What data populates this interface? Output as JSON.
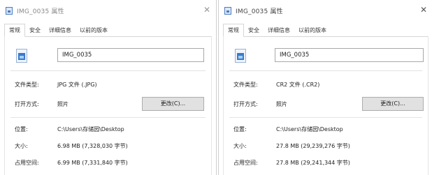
{
  "windows": [
    {
      "title": "IMG_0035 属性",
      "close_glyph": "✕",
      "tabs": [
        "常规",
        "安全",
        "详细信息",
        "以前的版本"
      ],
      "active_tab": "常规",
      "file_name": "IMG_0035",
      "fields": {
        "type_label": "文件类型:",
        "type_value": "JPG 文件 (.JPG)",
        "opens_label": "打开方式:",
        "opens_value": "照片",
        "change_button": "更改(C)...",
        "location_label": "位置:",
        "location_value": "C:\\Users\\存储园\\Desktop",
        "size_label": "大小:",
        "size_value": "6.98 MB (7,328,030 字节)",
        "disk_label": "占用空间:",
        "disk_value": "6.99 MB (7,331,840 字节)"
      }
    },
    {
      "title": "IMG_0035 属性",
      "close_glyph": "✕",
      "tabs": [
        "常规",
        "安全",
        "详细信息",
        "以前的版本"
      ],
      "active_tab": "常规",
      "file_name": "IMG_0035",
      "fields": {
        "type_label": "文件类型:",
        "type_value": "CR2 文件 (.CR2)",
        "opens_label": "打开方式:",
        "opens_value": "照片",
        "change_button": "更改(C)...",
        "location_label": "位置:",
        "location_value": "C:\\Users\\存储园\\Desktop",
        "size_label": "大小:",
        "size_value": "27.8 MB (29,239,276 字节)",
        "disk_label": "占用空间:",
        "disk_value": "27.8 MB (29,241,344 字节)"
      }
    }
  ]
}
